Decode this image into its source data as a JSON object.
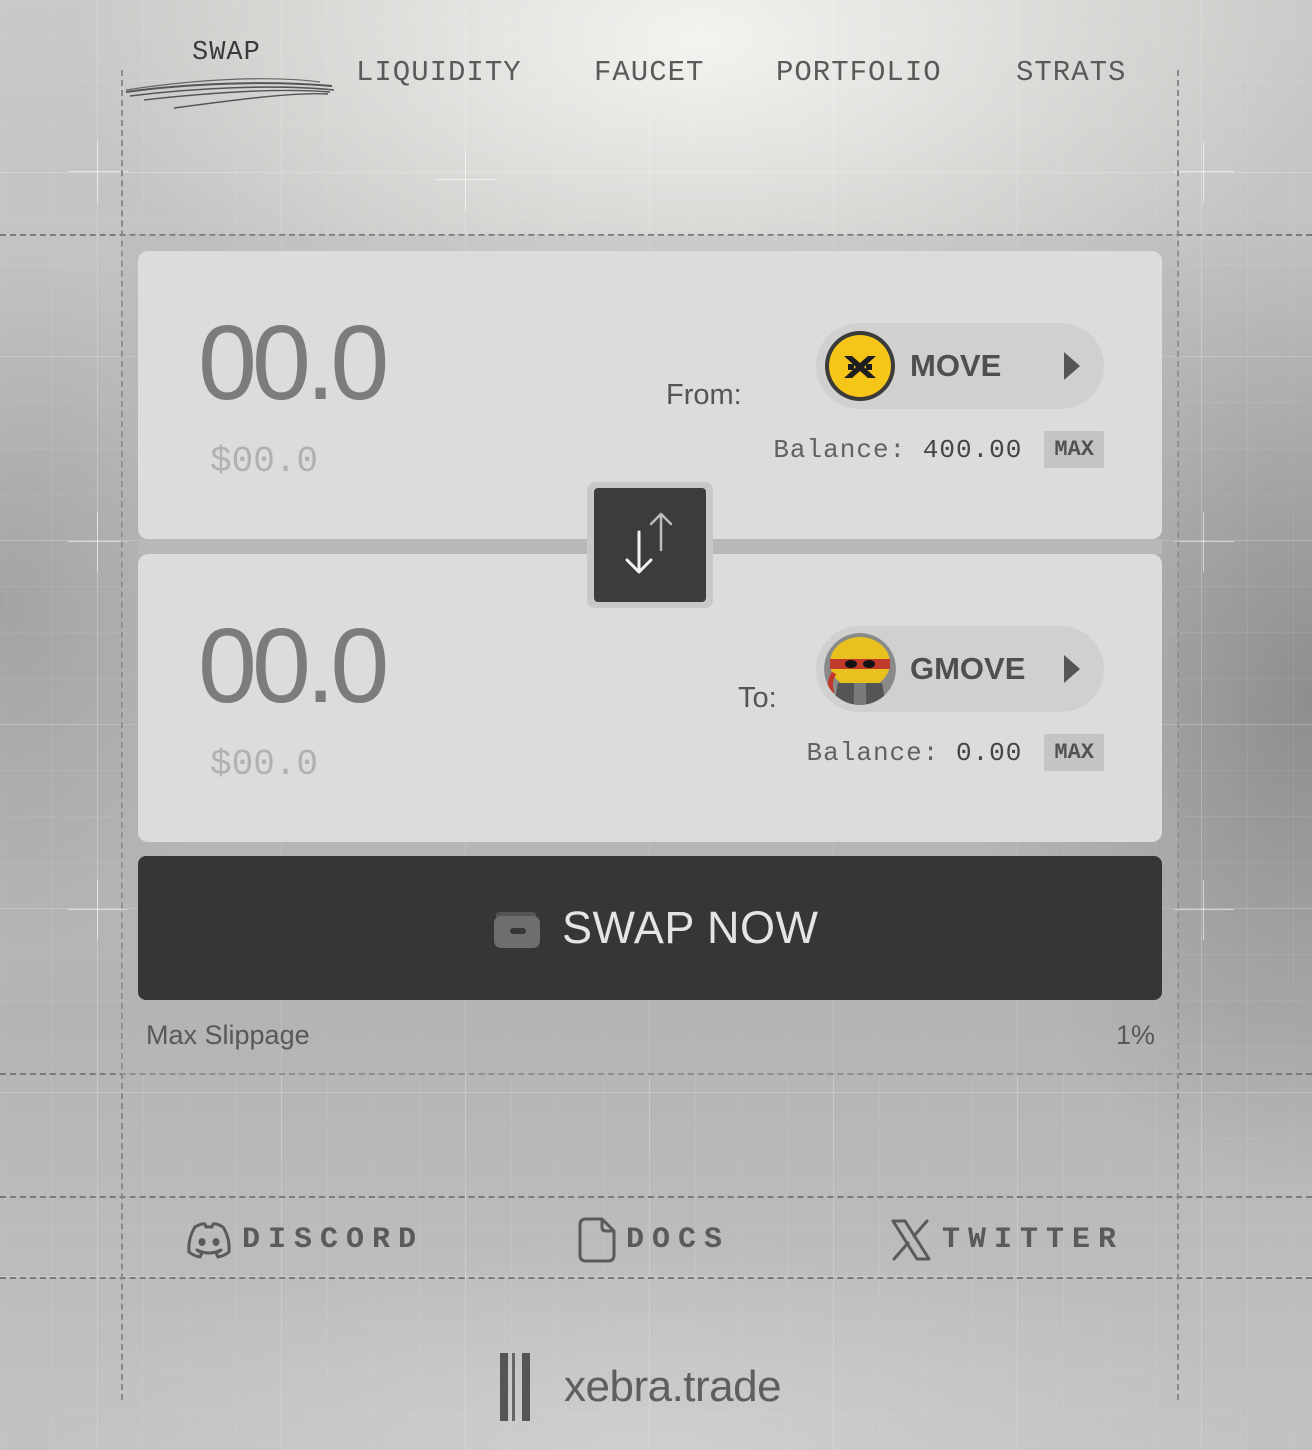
{
  "nav": {
    "items": [
      {
        "label": "SWAP",
        "active": true
      },
      {
        "label": "LIQUIDITY",
        "active": false
      },
      {
        "label": "FAUCET",
        "active": false
      },
      {
        "label": "PORTFOLIO",
        "active": false
      },
      {
        "label": "STRATS",
        "active": false
      }
    ]
  },
  "swap": {
    "from": {
      "direction_label": "From:",
      "amount": "00.0",
      "fiat_value": "$00.0",
      "token": {
        "symbol": "MOVE",
        "icon": "move-token-icon"
      },
      "balance_label": "Balance:",
      "balance_value": "400.00",
      "max_label": "MAX"
    },
    "to": {
      "direction_label": "To:",
      "amount": "00.0",
      "fiat_value": "$00.0",
      "token": {
        "symbol": "GMOVE",
        "icon": "gmove-token-icon"
      },
      "balance_label": "Balance:",
      "balance_value": "0.00",
      "max_label": "MAX"
    },
    "switch_icon": "swap-arrows-icon",
    "submit_label": "SWAP NOW",
    "submit_icon": "wallet-icon",
    "slippage_label": "Max Slippage",
    "slippage_value": "1%"
  },
  "footer": {
    "links": [
      {
        "label": "DISCORD",
        "icon": "discord-icon"
      },
      {
        "label": "DOCS",
        "icon": "document-icon"
      },
      {
        "label": "TWITTER",
        "icon": "x-icon"
      }
    ],
    "brand": "xebra.trade"
  },
  "colors": {
    "move_token_bg": "#f5c518",
    "button_dark": "#363636",
    "card_bg": "#dcdcdb"
  }
}
